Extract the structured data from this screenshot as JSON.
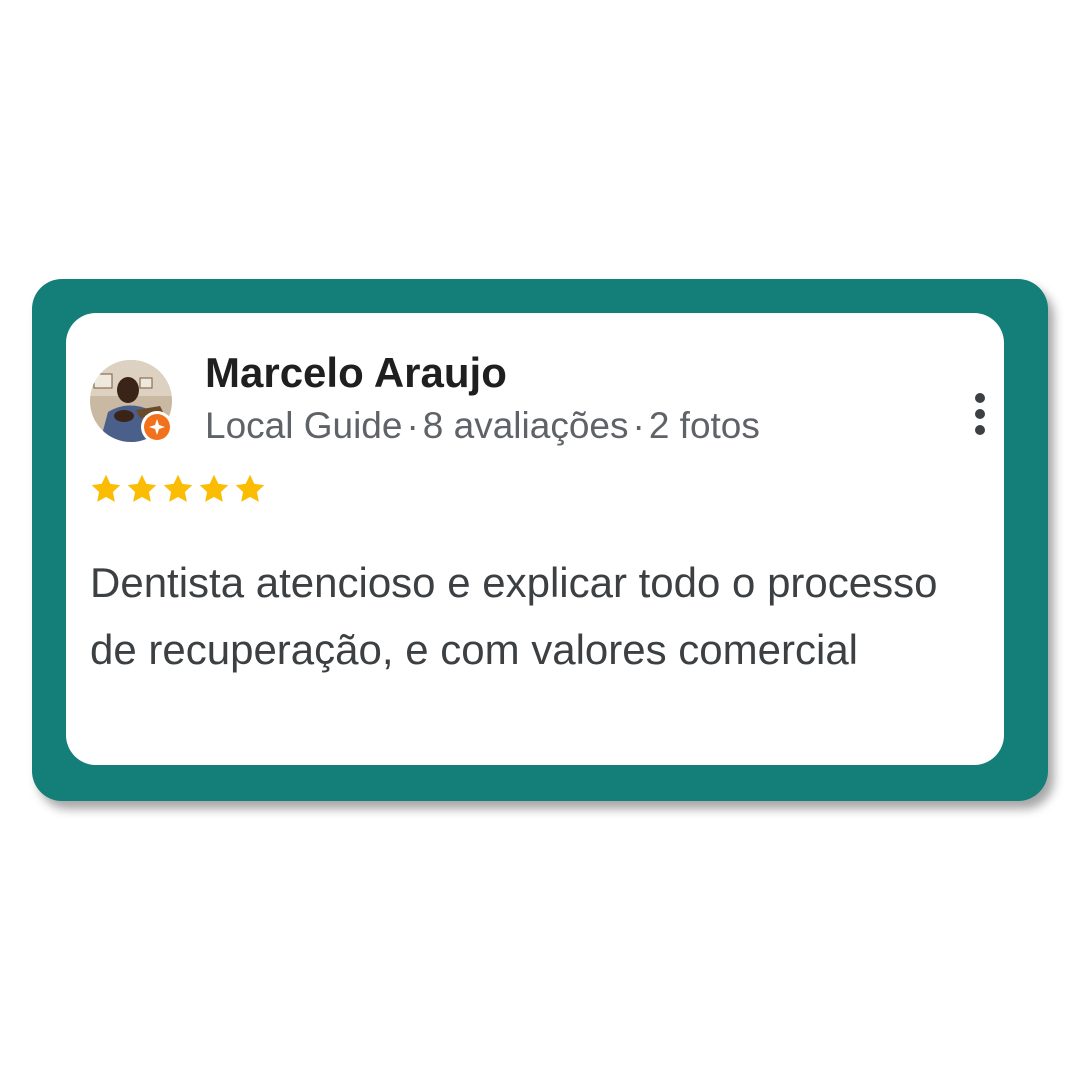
{
  "colors": {
    "frame": "#137f78",
    "card": "#ffffff",
    "star": "#fbbc04",
    "badge": "#f2711c",
    "name": "#1f1f1f",
    "meta": "#5f6368",
    "body": "#3c4043"
  },
  "review": {
    "reviewer_name": "Marcelo Araujo",
    "guide_label": "Local Guide",
    "reviews_count": "8 avaliações",
    "photos_count": "2 fotos",
    "separator": "·",
    "rating": 5,
    "text": "Dentista atencioso e explicar todo o processo de recuperação, e com valores comercial"
  },
  "icons": {
    "avatar": "profile-photo",
    "badge": "local-guide-badge-icon",
    "star": "star-icon",
    "more": "more-vertical-icon"
  }
}
